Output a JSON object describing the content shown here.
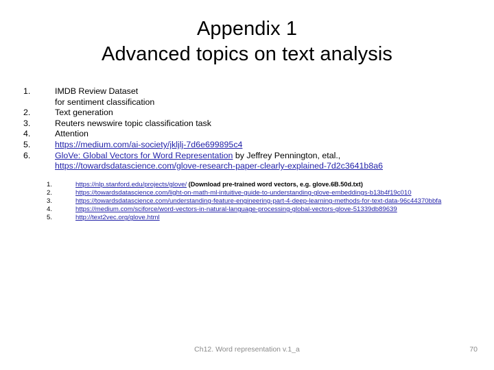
{
  "slide": {
    "title_line1": "Appendix 1",
    "title_line2": "Advanced topics on text analysis",
    "link_color": "#1F1FA8",
    "text_color": "#000000",
    "background_color": "#FFFFFF"
  },
  "outline": [
    {
      "num": "1.",
      "line1": "IMDB Review Dataset",
      "line2": "for sentiment classification",
      "is_link": false
    },
    {
      "num": "2.",
      "line1": "Text generation",
      "is_link": false
    },
    {
      "num": "3.",
      "line1": "Reuters newswire topic classification task",
      "is_link": false
    },
    {
      "num": "4.",
      "line1": "Attention",
      "is_link": false
    },
    {
      "num": "5.",
      "line1": "https://medium.com/ai-society/jkljlj-7d6e699895c4",
      "is_link": true
    },
    {
      "num": "6.",
      "link_text": "GloVe: Global Vectors for Word Representation",
      "after_text": " by Jeffrey Pennington, etal.,",
      "line2_link": "https://towardsdatascience.com/glove-research-paper-clearly-explained-7d2c3641b8a6",
      "is_link": true
    }
  ],
  "sublist": [
    {
      "num": "1.",
      "link": "https://nlp.stanford.edu/projects/glove/",
      "note": "  (Download pre-trained word vectors, e.g. glove.6B.50d.txt)"
    },
    {
      "num": "2.",
      "link": "https://towardsdatascience.com/light-on-math-ml-intuitive-guide-to-understanding-glove-embeddings-b13b4f19c010",
      "note": ""
    },
    {
      "num": "3.",
      "link": "https://towardsdatascience.com/understanding-feature-engineering-part-4-deep-learning-methods-for-text-data-96c44370bbfa",
      "note": ""
    },
    {
      "num": "4.",
      "link": "https://medium.com/sciforce/word-vectors-in-natural-language-processing-global-vectors-glove-51339db89639",
      "note": ""
    },
    {
      "num": "5.",
      "link": "http://text2vec.org/glove.html",
      "note": ""
    }
  ],
  "footer": {
    "center_text": "Ch12. Word representation v.1_a",
    "page_number": "70"
  }
}
